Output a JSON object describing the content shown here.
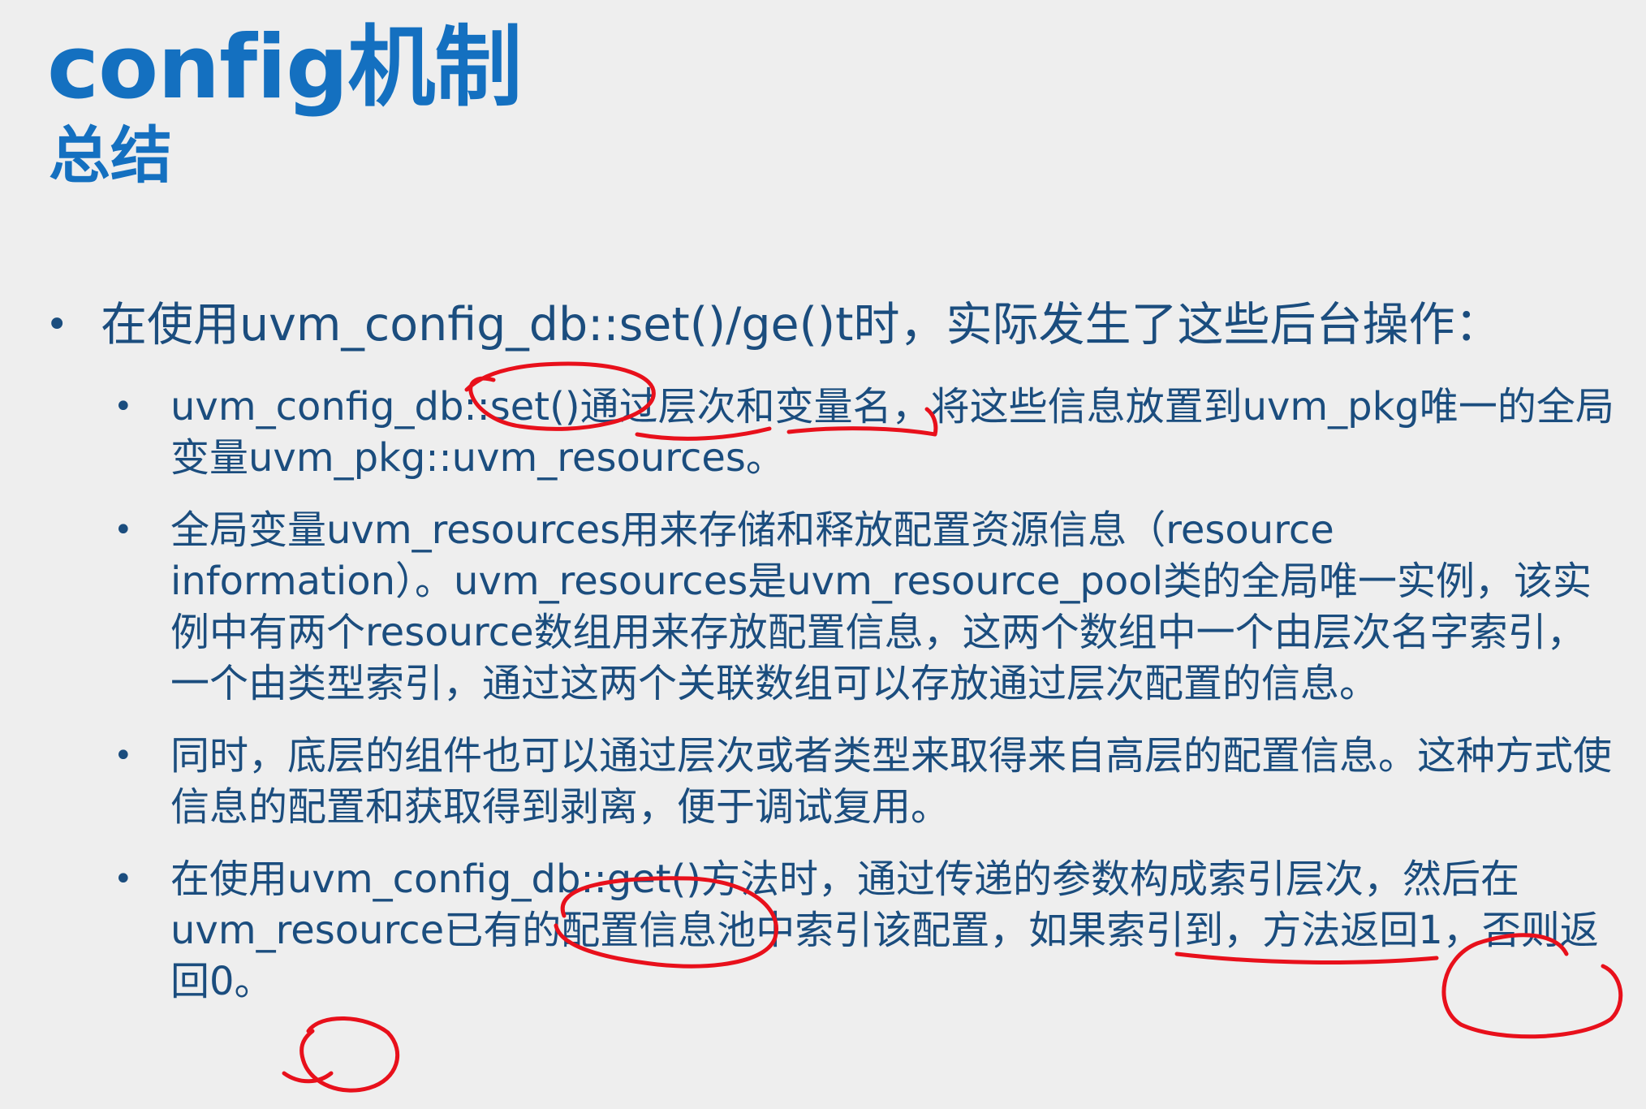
{
  "slide": {
    "title": "config机制",
    "subtitle": "总结",
    "main_bullet": "在使用uvm_config_db::set()/ge()t时，实际发生了这些后台操作：",
    "sub_bullets": [
      "uvm_config_db::set()通过层次和变量名，将这些信息放置到uvm_pkg唯一的全局变量uvm_pkg::uvm_resources。",
      "全局变量uvm_resources用来存储和释放配置资源信息（resource information）。uvm_resources是uvm_resource_pool类的全局唯一实例，该实例中有两个resource数组用来存放配置信息，这两个数组中一个由层次名字索引，一个由类型索引，通过这两个关联数组可以存放通过层次配置的信息。",
      "同时，底层的组件也可以通过层次或者类型来取得来自高层的配置信息。这种方式使信息的配置和获取得到剥离，便于调试复用。",
      "在使用uvm_config_db::get()方法时，通过传递的参数构成索引层次，然后在uvm_resource已有的配置信息池中索引该配置，如果索引到，方法返回1，否则返回0。"
    ]
  },
  "annotation_color": "#e8101b"
}
